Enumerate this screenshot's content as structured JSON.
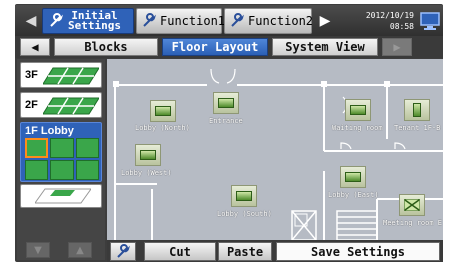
{
  "top_tabs": [
    {
      "label_line1": "Initial",
      "label_line2": "Settings"
    },
    {
      "label": "Function1"
    },
    {
      "label": "Function2"
    }
  ],
  "datetime": {
    "date": "2012/10/19",
    "time": "08:58"
  },
  "view_tabs": [
    {
      "label": "Blocks"
    },
    {
      "label": "Floor Layout"
    },
    {
      "label": "System View"
    }
  ],
  "floors": [
    {
      "label": "3F"
    },
    {
      "label": "2F"
    },
    {
      "label": "1F Lobby"
    }
  ],
  "rooms": [
    {
      "label": "Lobby (North)"
    },
    {
      "label": "Entrance"
    },
    {
      "label": "Waiting room"
    },
    {
      "label": "Tenant 1F-B"
    },
    {
      "label": "Lobby (West)"
    },
    {
      "label": "Lobby (East)"
    },
    {
      "label": "Lobby (South)"
    },
    {
      "label": "Meeting room E"
    }
  ],
  "bottom_buttons": {
    "cut": "Cut",
    "paste": "Paste",
    "save": "Save Settings"
  },
  "colors": {
    "active_tab": "#2f62b8",
    "unit_green": "#3aa64a",
    "selection": "#ff8c1a",
    "plan_bg": "#b6bbc4"
  }
}
